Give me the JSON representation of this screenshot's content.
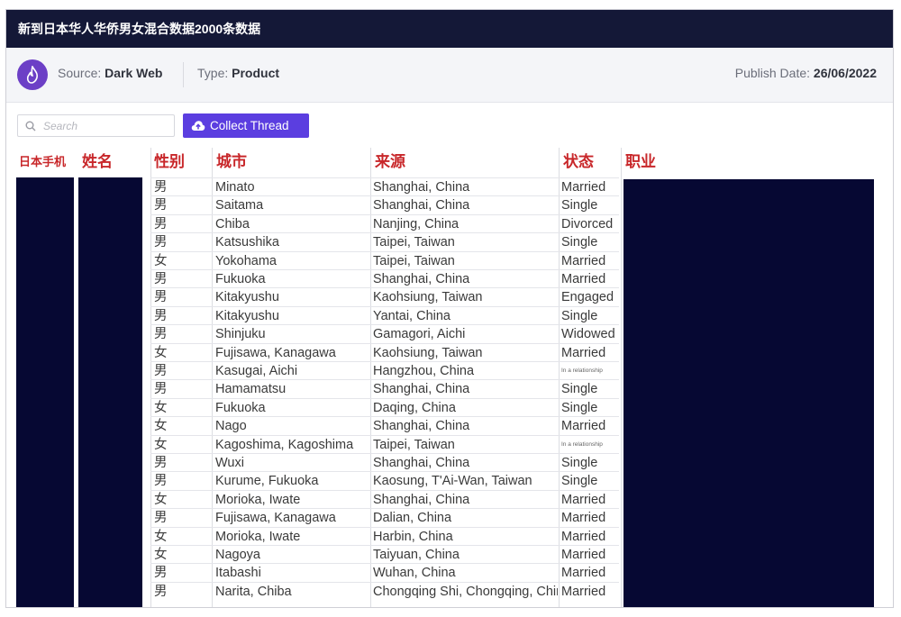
{
  "header": {
    "title": "新到日本华人华侨男女混合数据2000条数据"
  },
  "meta": {
    "source_label": "Source: ",
    "source_value": "Dark Web",
    "type_label": "Type: ",
    "type_value": "Product",
    "date_label": "Publish Date: ",
    "date_value": "26/06/2022"
  },
  "search": {
    "placeholder": "Search",
    "value": ""
  },
  "actions": {
    "collect_label": "Collect Thread"
  },
  "colors": {
    "titlebar": "#141837",
    "accent": "#5b3ee0",
    "logo": "#6c3fc6",
    "redaction": "#060833",
    "header_text": "#c8272a"
  },
  "icons": {
    "logo": "flame-icon",
    "search": "search-icon",
    "collect": "cloud-upload-icon"
  },
  "table": {
    "columns": [
      "日本手机",
      "姓名",
      "性别",
      "城市",
      "来源",
      "状态",
      "职业"
    ],
    "rows": [
      {
        "gender": "男",
        "city": "Minato",
        "source": "Shanghai, China",
        "status": "Married"
      },
      {
        "gender": "男",
        "city": "Saitama",
        "source": "Shanghai, China",
        "status": "Single"
      },
      {
        "gender": "男",
        "city": "Chiba",
        "source": "Nanjing, China",
        "status": "Divorced"
      },
      {
        "gender": "男",
        "city": "Katsushika",
        "source": "Taipei, Taiwan",
        "status": "Single"
      },
      {
        "gender": "女",
        "city": "Yokohama",
        "source": "Taipei, Taiwan",
        "status": "Married"
      },
      {
        "gender": "男",
        "city": "Fukuoka",
        "source": "Shanghai, China",
        "status": "Married"
      },
      {
        "gender": "男",
        "city": "Kitakyushu",
        "source": "Kaohsiung, Taiwan",
        "status": "Engaged"
      },
      {
        "gender": "男",
        "city": "Kitakyushu",
        "source": "Yantai, China",
        "status": "Single"
      },
      {
        "gender": "男",
        "city": "Shinjuku",
        "source": "Gamagori, Aichi",
        "status": "Widowed"
      },
      {
        "gender": "女",
        "city": "Fujisawa, Kanagawa",
        "source": "Kaohsiung, Taiwan",
        "status": "Married"
      },
      {
        "gender": "男",
        "city": "Kasugai, Aichi",
        "source": "Hangzhou, China",
        "status": "In a relationship"
      },
      {
        "gender": "男",
        "city": "Hamamatsu",
        "source": "Shanghai, China",
        "status": "Single"
      },
      {
        "gender": "女",
        "city": "Fukuoka",
        "source": "Daqing, China",
        "status": "Single"
      },
      {
        "gender": "女",
        "city": "Nago",
        "source": "Shanghai, China",
        "status": "Married"
      },
      {
        "gender": "女",
        "city": "Kagoshima, Kagoshima",
        "source": "Taipei, Taiwan",
        "status": "In a relationship"
      },
      {
        "gender": "男",
        "city": "Wuxi",
        "source": "Shanghai, China",
        "status": "Single"
      },
      {
        "gender": "男",
        "city": "Kurume, Fukuoka",
        "source": "Kaosung, T'Ai-Wan, Taiwan",
        "status": "Single"
      },
      {
        "gender": "女",
        "city": "Morioka, Iwate",
        "source": "Shanghai, China",
        "status": "Married"
      },
      {
        "gender": "男",
        "city": "Fujisawa, Kanagawa",
        "source": "Dalian, China",
        "status": "Married"
      },
      {
        "gender": "女",
        "city": "Morioka, Iwate",
        "source": "Harbin, China",
        "status": "Married"
      },
      {
        "gender": "女",
        "city": "Nagoya",
        "source": "Taiyuan, China",
        "status": "Married"
      },
      {
        "gender": "男",
        "city": "Itabashi",
        "source": "Wuhan, China",
        "status": "Married"
      },
      {
        "gender": "男",
        "city": "Narita, Chiba",
        "source": "Chongqing Shi, Chongqing, China",
        "status": "Married"
      }
    ]
  }
}
